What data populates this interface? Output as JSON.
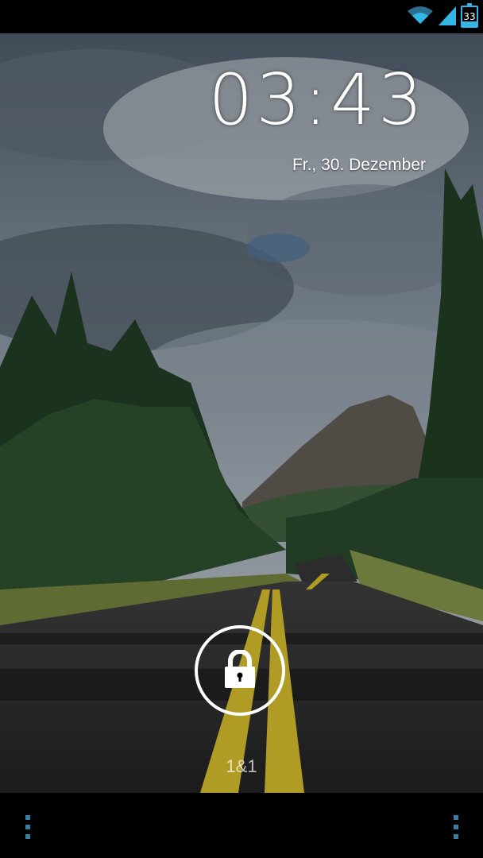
{
  "status_bar": {
    "battery_level": "33",
    "wifi_icon": "wifi-icon",
    "signal_icon": "cell-signal-icon",
    "accent_color": "#33b5e5"
  },
  "lockscreen": {
    "time": "03:43",
    "date": "Fr., 30. Dezember",
    "carrier": "1&1",
    "lock_icon": "lock-icon"
  },
  "nav_bar": {
    "left_icon": "overflow-menu-icon",
    "right_icon": "overflow-menu-icon"
  }
}
